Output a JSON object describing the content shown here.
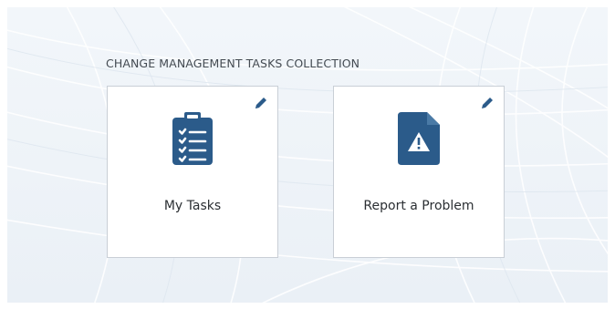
{
  "section": {
    "title": "CHANGE MANAGEMENT TASKS COLLECTION"
  },
  "tiles": [
    {
      "label": "My Tasks",
      "icon": "clipboard-checklist-icon",
      "edit_icon": "pencil-icon"
    },
    {
      "label": "Report a Problem",
      "icon": "document-warning-icon",
      "edit_icon": "pencil-icon"
    }
  ],
  "colors": {
    "icon_blue": "#2b5b8a",
    "tile_border": "#c9cfd6",
    "text": "#2b2f33"
  }
}
